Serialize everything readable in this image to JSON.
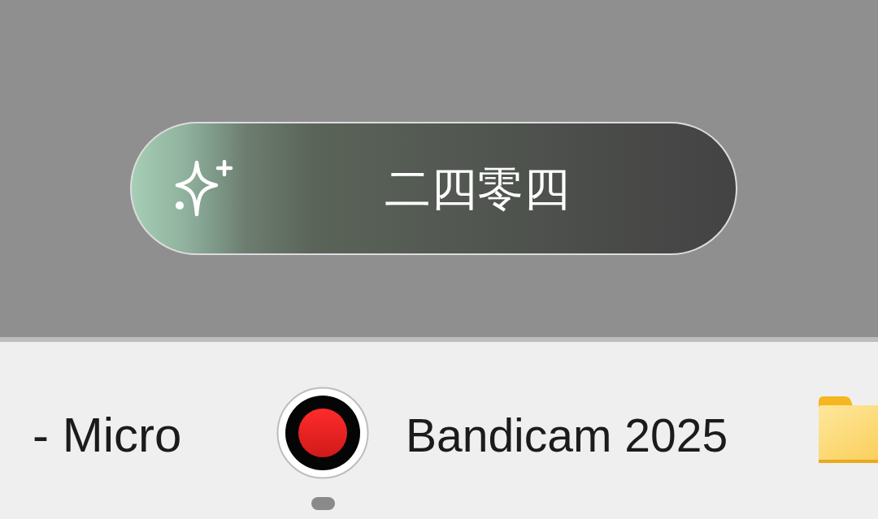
{
  "action_button": {
    "label": "二四零四"
  },
  "taskbar": {
    "items": [
      {
        "kind": "window",
        "label": "- Micro"
      },
      {
        "kind": "recorder",
        "label": "Bandicam 2025",
        "running": true
      },
      {
        "kind": "folder"
      }
    ]
  }
}
